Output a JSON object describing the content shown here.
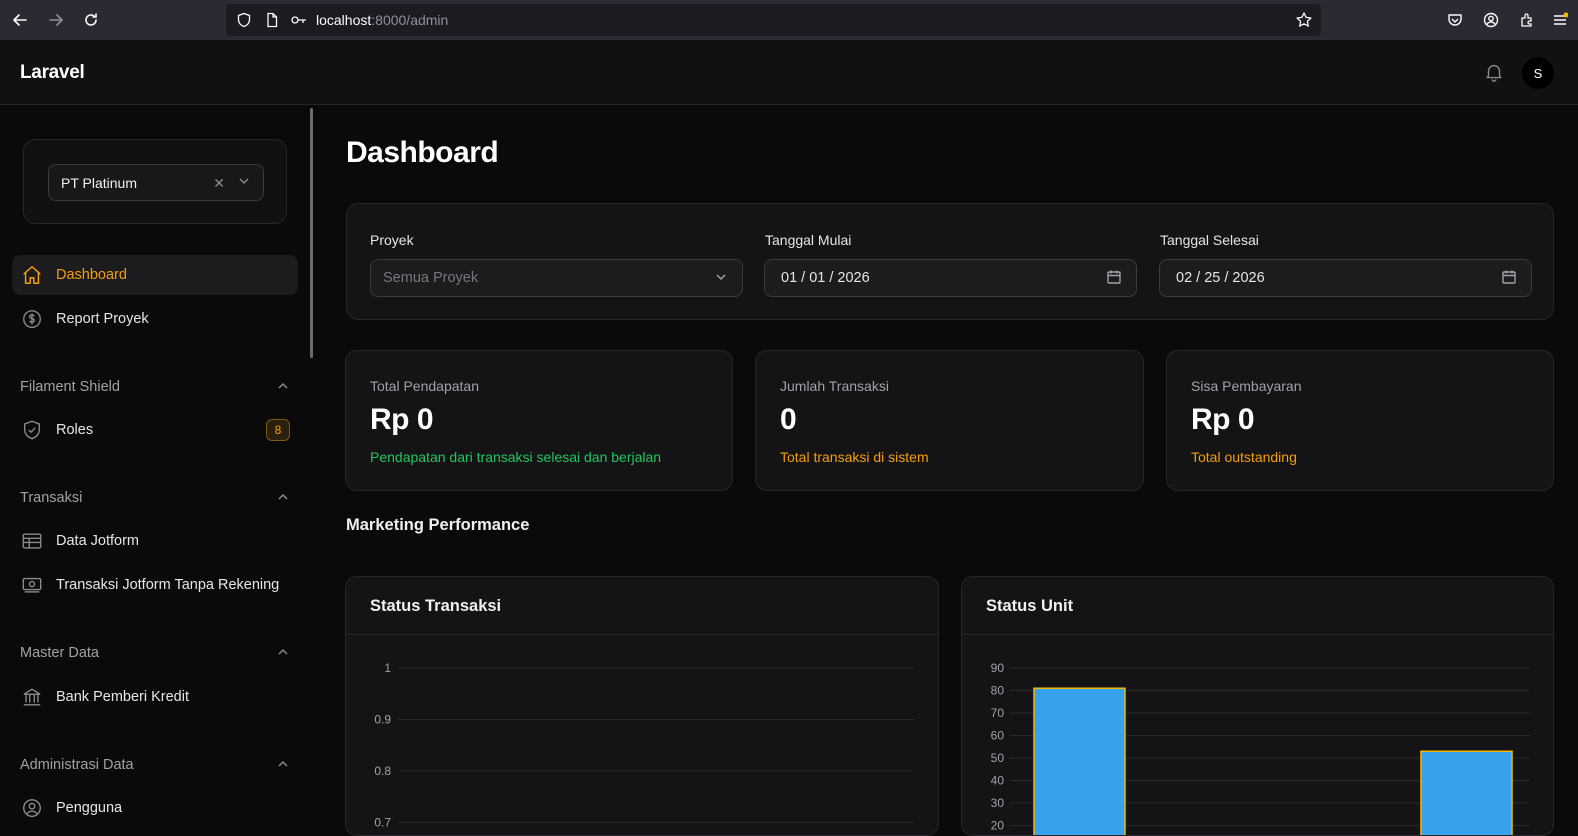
{
  "browser": {
    "url_host": "localhost",
    "url_rest": ":8000/admin"
  },
  "app": {
    "brand": "Laravel",
    "avatar_initial": "S"
  },
  "sidebar": {
    "tenant": "PT Platinum",
    "items": [
      {
        "label": "Dashboard",
        "icon": "home-icon",
        "active": true
      },
      {
        "label": "Report Proyek",
        "icon": "dollar-circle-icon"
      }
    ],
    "groups": [
      {
        "label": "Filament Shield",
        "items": [
          {
            "label": "Roles",
            "icon": "shield-check-icon",
            "badge": "8"
          }
        ]
      },
      {
        "label": "Transaksi",
        "items": [
          {
            "label": "Data Jotform",
            "icon": "table-icon"
          },
          {
            "label": "Transaksi Jotform Tanpa Rekening",
            "icon": "banknote-icon"
          }
        ]
      },
      {
        "label": "Master Data",
        "items": [
          {
            "label": "Bank Pemberi Kredit",
            "icon": "building-library-icon"
          }
        ]
      },
      {
        "label": "Administrasi Data",
        "items": [
          {
            "label": "Pengguna",
            "icon": "user-circle-icon"
          }
        ]
      }
    ]
  },
  "main": {
    "title": "Dashboard",
    "filters": {
      "project_label": "Proyek",
      "project_placeholder": "Semua Proyek",
      "start_label": "Tanggal Mulai",
      "start_value": "01 / 01 / 2026",
      "end_label": "Tanggal Selesai",
      "end_value": "02 / 25 / 2026"
    },
    "stats": [
      {
        "label": "Total Pendapatan",
        "value": "Rp 0",
        "desc": "Pendapatan dari transaksi selesai dan berjalan",
        "desc_color": "#22c55e"
      },
      {
        "label": "Jumlah Transaksi",
        "value": "0",
        "desc": "Total transaksi di sistem",
        "desc_color": "#f59e0b"
      },
      {
        "label": "Sisa Pembayaran",
        "value": "Rp 0",
        "desc": "Total outstanding",
        "desc_color": "#f59e0b"
      }
    ],
    "section_title": "Marketing Performance",
    "charts": {
      "status_transaksi_title": "Status Transaksi",
      "status_unit_title": "Status Unit"
    }
  },
  "colors": {
    "accent": "#f59e0b",
    "bar_fill": "#36a2eb",
    "bar_border": "#f5b800"
  },
  "chart_data": [
    {
      "type": "line",
      "title": "Status Transaksi",
      "y_ticks": [
        "1",
        "0.9",
        "0.8",
        "0.7"
      ],
      "ylim": [
        0.7,
        1
      ],
      "series": []
    },
    {
      "type": "bar",
      "title": "Status Unit",
      "y_ticks": [
        "90",
        "80",
        "70",
        "60",
        "50",
        "40",
        "30",
        "20"
      ],
      "ylim": [
        20,
        90
      ],
      "values": [
        81,
        53
      ],
      "grid": true
    }
  ]
}
